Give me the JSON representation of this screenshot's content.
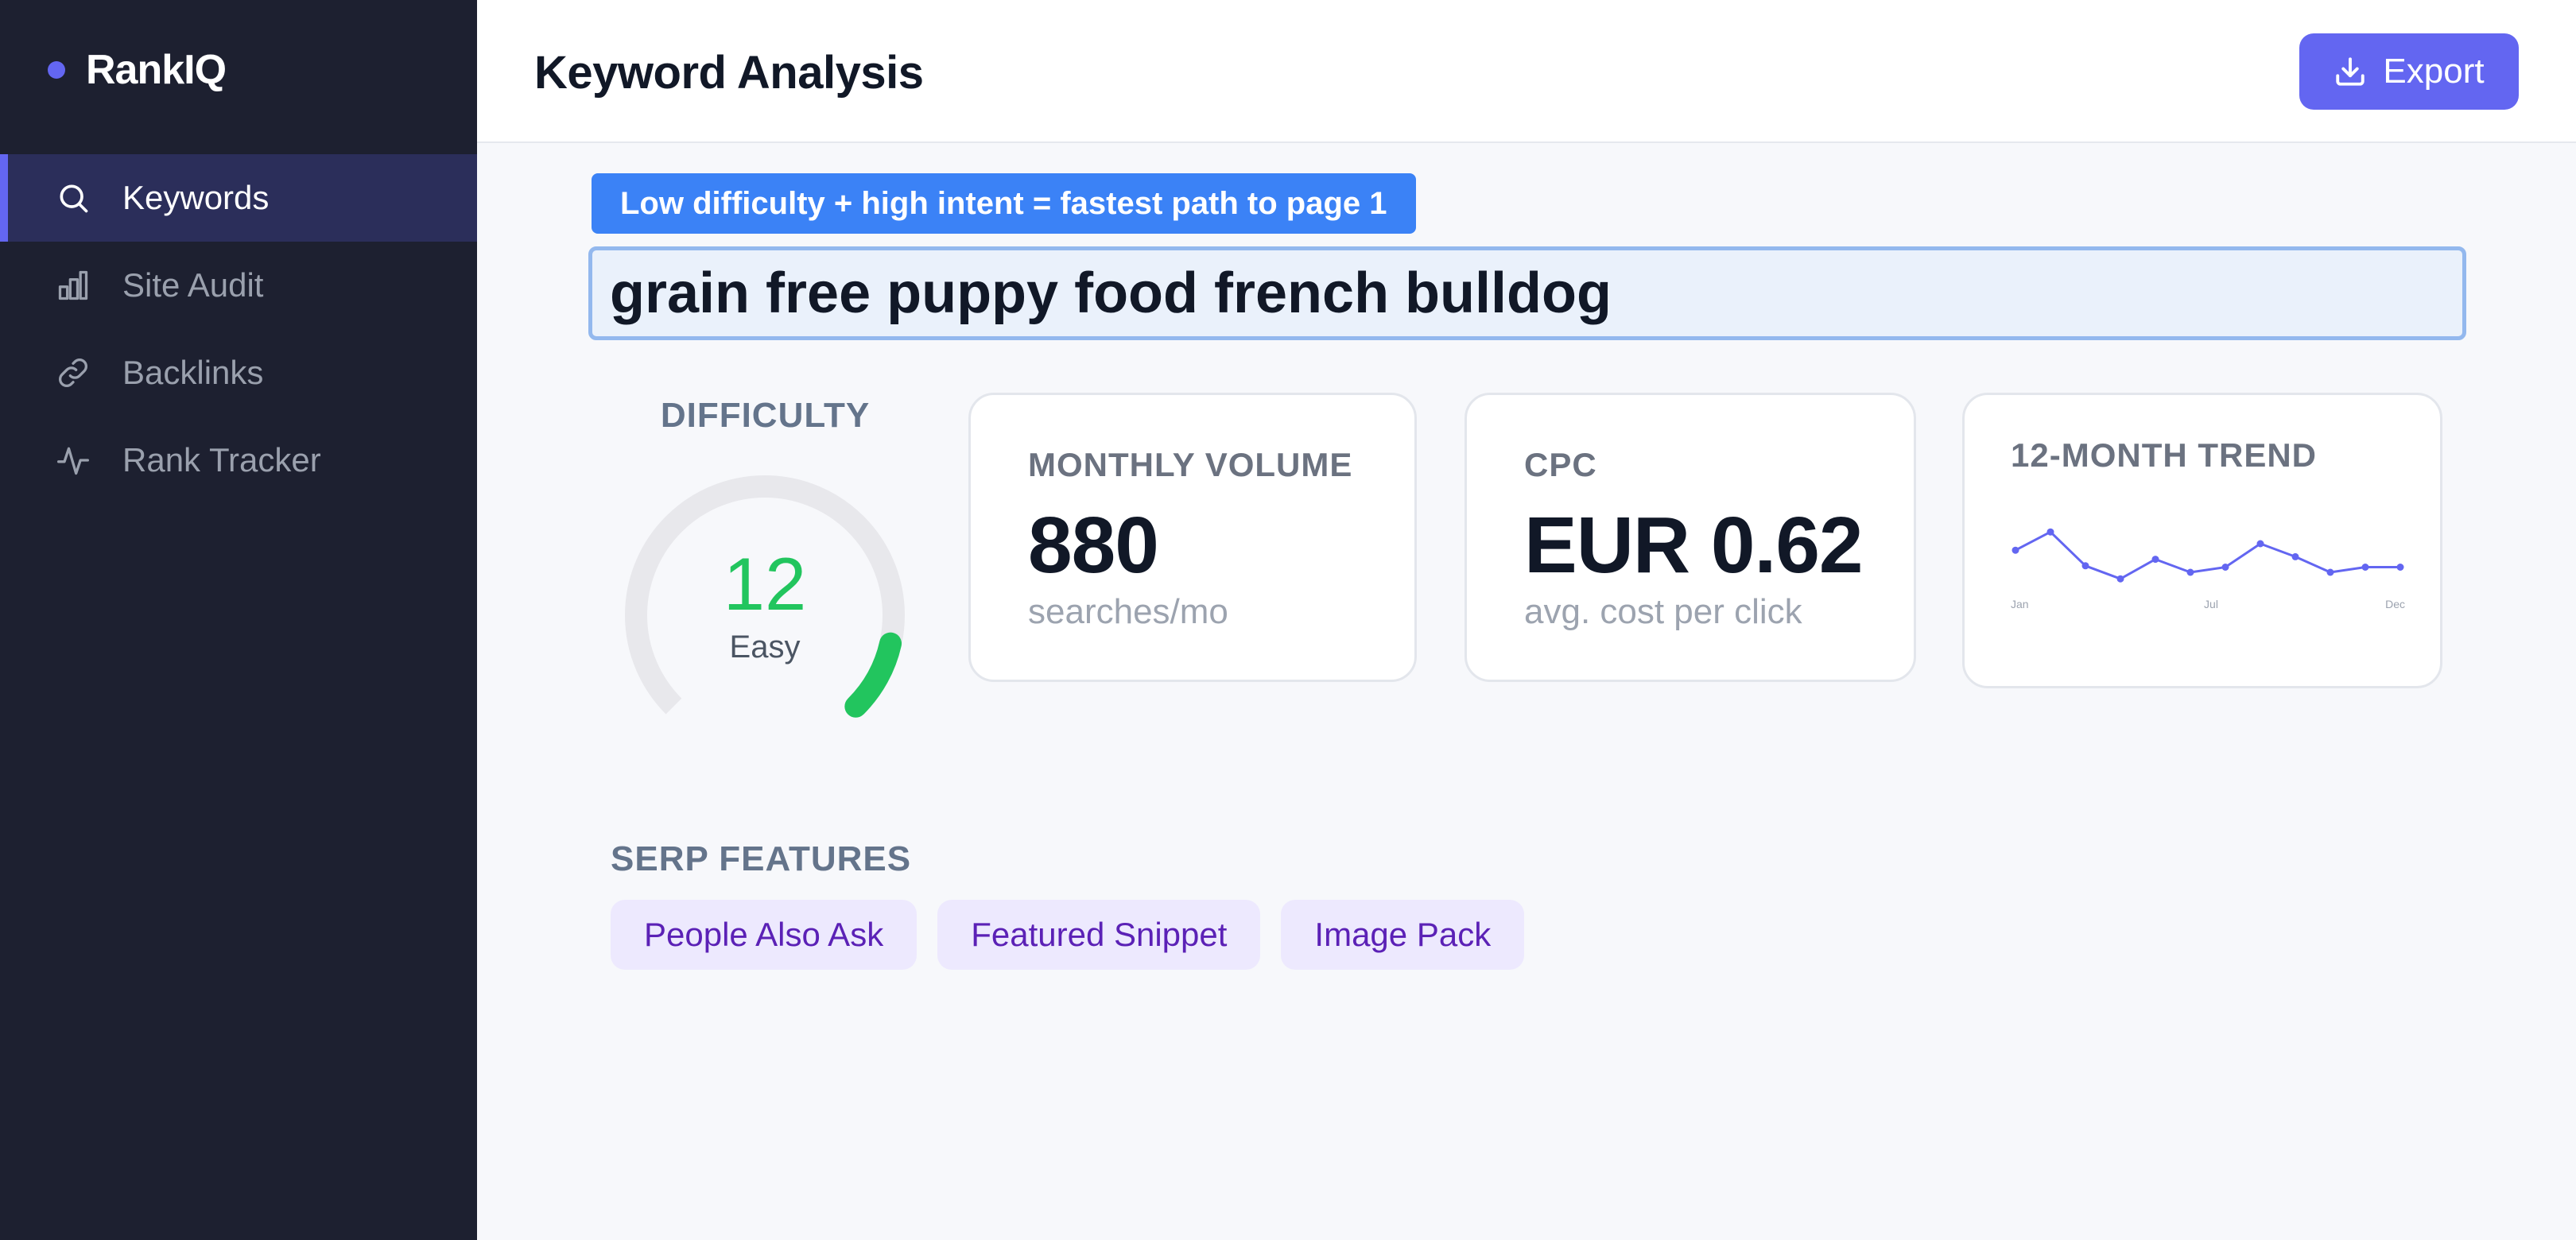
{
  "app": {
    "brand": "RankIQ",
    "accent": "#6366f1"
  },
  "sidebar": {
    "items": [
      {
        "label": "Keywords",
        "icon": "search-icon",
        "active": true
      },
      {
        "label": "Site Audit",
        "icon": "bar-chart-icon",
        "active": false
      },
      {
        "label": "Backlinks",
        "icon": "link-icon",
        "active": false
      },
      {
        "label": "Rank Tracker",
        "icon": "activity-icon",
        "active": false
      }
    ]
  },
  "header": {
    "title": "Keyword Analysis",
    "export_label": "Export"
  },
  "tip": "Low difficulty + high intent = fastest path to page 1",
  "keyword": {
    "value": "grain free puppy food french bulldog"
  },
  "difficulty": {
    "label": "DIFFICULTY",
    "score": "12",
    "level": "Easy",
    "fraction": 0.12,
    "color": "#22c55e"
  },
  "volume": {
    "label": "MONTHLY VOLUME",
    "value": "880",
    "sub": "searches/mo"
  },
  "cpc": {
    "label": "CPC",
    "value": "EUR 0.62",
    "sub": "avg. cost per click"
  },
  "trend": {
    "label": "12-MONTH TREND",
    "x_ticks": [
      "Jan",
      "Jul",
      "Dec"
    ],
    "chart_data": {
      "type": "line",
      "x": [
        "Jan",
        "Feb",
        "Mar",
        "Apr",
        "May",
        "Jun",
        "Jul",
        "Aug",
        "Sep",
        "Oct",
        "Nov",
        "Dec"
      ],
      "values": [
        71,
        85,
        59,
        49,
        64,
        54,
        58,
        76,
        66,
        54,
        58,
        58
      ],
      "ylim": [
        40,
        90
      ]
    }
  },
  "serp": {
    "label": "SERP FEATURES",
    "chips": [
      "People Also Ask",
      "Featured Snippet",
      "Image Pack"
    ]
  }
}
